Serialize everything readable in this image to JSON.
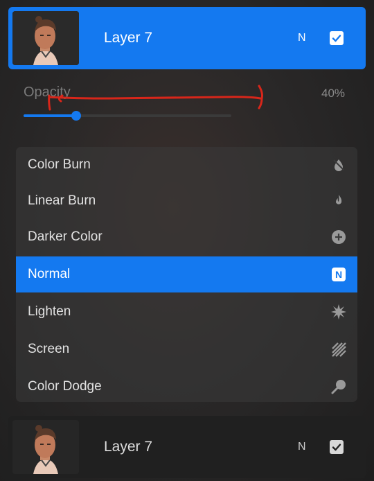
{
  "active_layer": {
    "name": "Layer 7",
    "blend_mode_letter": "N",
    "visible": true
  },
  "opacity": {
    "label": "Opacity",
    "value_text": "40%",
    "value_fraction": 0.4
  },
  "blend_modes": [
    {
      "label": "Color Burn",
      "icon": "burn-drop-icon",
      "selected": false
    },
    {
      "label": "Linear Burn",
      "icon": "flame-icon",
      "selected": false
    },
    {
      "label": "Darker Color",
      "icon": "plus-circle-icon",
      "selected": false
    },
    {
      "label": "Normal",
      "icon": "n-badge-icon",
      "selected": true,
      "icon_text": "N"
    },
    {
      "label": "Lighten",
      "icon": "starburst-icon",
      "selected": false
    },
    {
      "label": "Screen",
      "icon": "diagonal-stripes-icon",
      "selected": false
    },
    {
      "label": "Color Dodge",
      "icon": "magnifier-icon",
      "selected": false
    }
  ],
  "lower_layer": {
    "name": "Layer 7",
    "blend_mode_letter": "N",
    "visible": true
  },
  "colors": {
    "accent": "#1479f0",
    "annotation": "#d8261a"
  }
}
